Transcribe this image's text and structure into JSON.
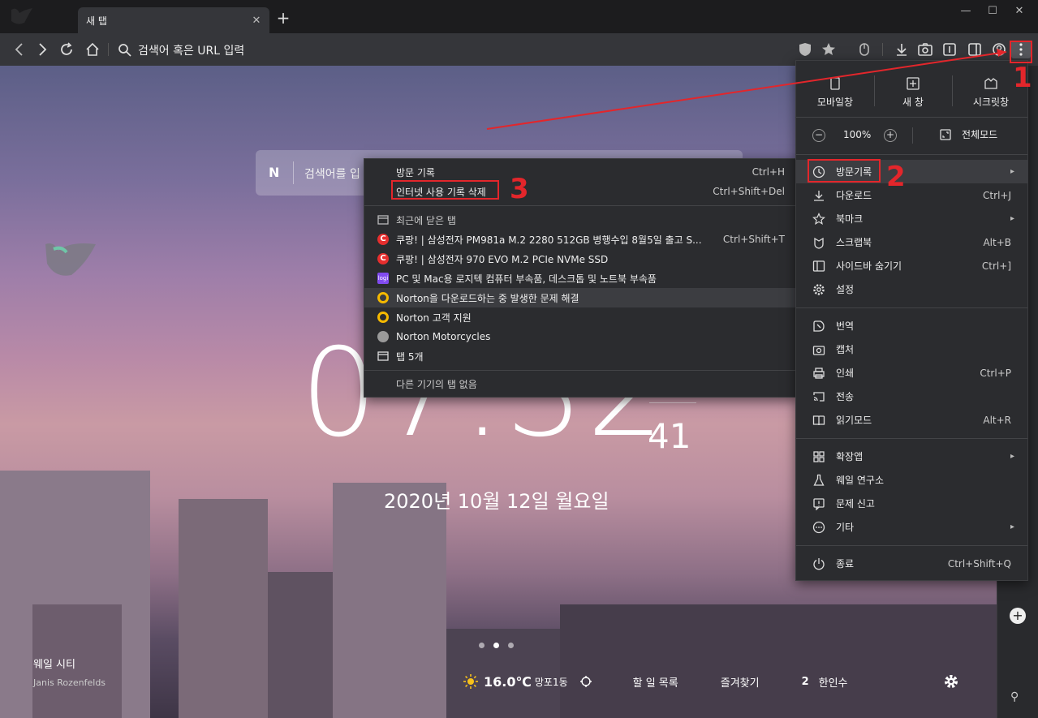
{
  "tab": {
    "title": "새 탭",
    "close": "✕",
    "new_tab": "+"
  },
  "window": {
    "minimize": "—",
    "maximize": "☐",
    "close": "✕"
  },
  "toolbar": {
    "address_placeholder": "검색어 혹은 URL 입력"
  },
  "newtab_page": {
    "search_placeholder": "검색어를 입",
    "search_engine_logo": "N",
    "clock": {
      "hm": "07:32",
      "seconds": "41"
    },
    "date": "2020년 10월 12일 월요일",
    "city": "웨일 시티",
    "photo_credit": "Janis Rozenfelds",
    "weather": {
      "temp": "16.0℃",
      "location": "망포1동"
    },
    "bottom_links": [
      "할 일 목록",
      "즐겨찾기"
    ],
    "hanin_count": "2",
    "hanin_label": "한인수",
    "carousel": {
      "count": 3,
      "active": 1
    }
  },
  "main_menu": {
    "top_buttons": [
      "모바일창",
      "새 창",
      "시크릿창"
    ],
    "zoom": {
      "minus": "−",
      "value": "100%",
      "plus": "+",
      "fullscreen": "전체모드"
    },
    "items": [
      {
        "label": "방문기록",
        "shortcut": "",
        "arrow": "▸",
        "icon": "history-icon"
      },
      {
        "label": "다운로드",
        "shortcut": "Ctrl+J",
        "arrow": "",
        "icon": "download-icon"
      },
      {
        "label": "북마크",
        "shortcut": "",
        "arrow": "▸",
        "icon": "star-icon"
      },
      {
        "label": "스크랩북",
        "shortcut": "Alt+B",
        "arrow": "",
        "icon": "scrapbook-icon"
      },
      {
        "label": "사이드바 숨기기",
        "shortcut": "Ctrl+]",
        "arrow": "",
        "icon": "sidebar-icon"
      },
      {
        "label": "설정",
        "shortcut": "",
        "arrow": "",
        "icon": "gear-icon"
      },
      {
        "label": "번역",
        "shortcut": "",
        "arrow": "",
        "icon": "translate-icon"
      },
      {
        "label": "캡처",
        "shortcut": "",
        "arrow": "",
        "icon": "camera-icon"
      },
      {
        "label": "인쇄",
        "shortcut": "Ctrl+P",
        "arrow": "",
        "icon": "print-icon"
      },
      {
        "label": "전송",
        "shortcut": "",
        "arrow": "",
        "icon": "cast-icon"
      },
      {
        "label": "읽기모드",
        "shortcut": "Alt+R",
        "arrow": "",
        "icon": "book-icon"
      },
      {
        "label": "확장앱",
        "shortcut": "",
        "arrow": "▸",
        "icon": "extensions-icon"
      },
      {
        "label": "웨일 연구소",
        "shortcut": "",
        "arrow": "",
        "icon": "flask-icon"
      },
      {
        "label": "문제 신고",
        "shortcut": "",
        "arrow": "",
        "icon": "report-icon"
      },
      {
        "label": "기타",
        "shortcut": "",
        "arrow": "▸",
        "icon": "more-icon"
      },
      {
        "label": "종료",
        "shortcut": "Ctrl+Shift+Q",
        "arrow": "",
        "icon": "power-icon"
      }
    ]
  },
  "history_menu": {
    "history": {
      "label": "방문 기록",
      "shortcut": "Ctrl+H"
    },
    "clear": {
      "label": "인터넷 사용 기록 삭제",
      "shortcut": "Ctrl+Shift+Del"
    },
    "recently_closed": "최근에 닫은 탭",
    "entries": [
      {
        "label": "쿠팡! | 삼성전자 PM981a M.2 2280 512GB 병행수입 8월5일 출고 S...",
        "shortcut": "Ctrl+Shift+T",
        "favicon": "C"
      },
      {
        "label": "쿠팡! | 삼성전자 970 EVO M.2 PCIe NVMe SSD",
        "shortcut": "",
        "favicon": "C"
      },
      {
        "label": "PC 및 Mac용 로지텍 컴퓨터 부속품, 데스크톱 및 노트북 부속품",
        "shortcut": "",
        "favicon": "logi"
      },
      {
        "label": "Norton을 다운로드하는 중 발생한 문제 해결",
        "shortcut": "",
        "favicon": ""
      },
      {
        "label": "Norton 고객 지원",
        "shortcut": "",
        "favicon": ""
      },
      {
        "label": "Norton Motorcycles",
        "shortcut": "",
        "favicon": ""
      },
      {
        "label": "탭 5개",
        "shortcut": "",
        "favicon": ""
      }
    ],
    "other_devices": "다른 기기의 탭 없음"
  },
  "annotations": {
    "step1": "1",
    "step2": "2",
    "step3": "3"
  },
  "colors": {
    "annotation": "#e3262b",
    "menu_bg": "#2b2c2f",
    "toolbar_bg": "#35363a"
  }
}
